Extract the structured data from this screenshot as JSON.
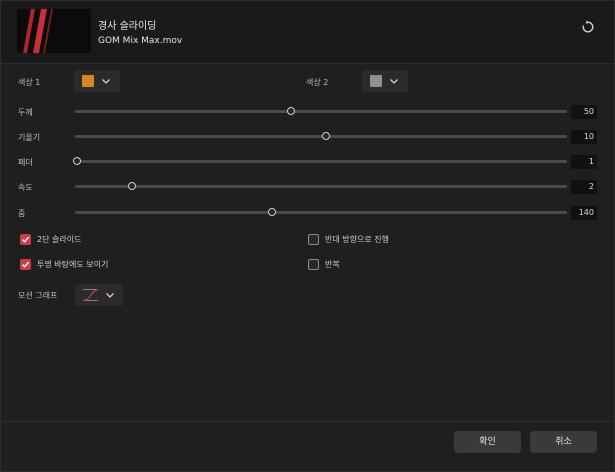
{
  "header": {
    "title": "경사 슬라이딩",
    "file_name": "GOM Mix Max.mov",
    "reset_icon": "reset-icon"
  },
  "colors": {
    "color1_label": "색상 1",
    "color1_value": "#d88620",
    "color2_label": "색상 2",
    "color2_value": "#8f8f8f"
  },
  "sliders": [
    {
      "label": "두께",
      "value": "50",
      "fraction": 0.44
    },
    {
      "label": "기울기",
      "value": "10",
      "fraction": 0.51
    },
    {
      "label": "페더",
      "value": "1",
      "fraction": 0.005
    },
    {
      "label": "속도",
      "value": "2",
      "fraction": 0.115
    },
    {
      "label": "줌",
      "value": "140",
      "fraction": 0.4
    }
  ],
  "options": {
    "two_step_label": "2단 슬라이드",
    "two_step_checked": true,
    "transparent_label": "투명 바탕에도 보이기",
    "transparent_checked": true,
    "reverse_label": "반대 방향으로 진행",
    "reverse_checked": false,
    "repeat_label": "반복",
    "repeat_checked": false
  },
  "motion_graph": {
    "label": "모션 그래프"
  },
  "footer": {
    "ok_label": "확인",
    "cancel_label": "취소"
  },
  "theme": {
    "accent": "#cc3c49",
    "background": "#1f1f1f"
  }
}
